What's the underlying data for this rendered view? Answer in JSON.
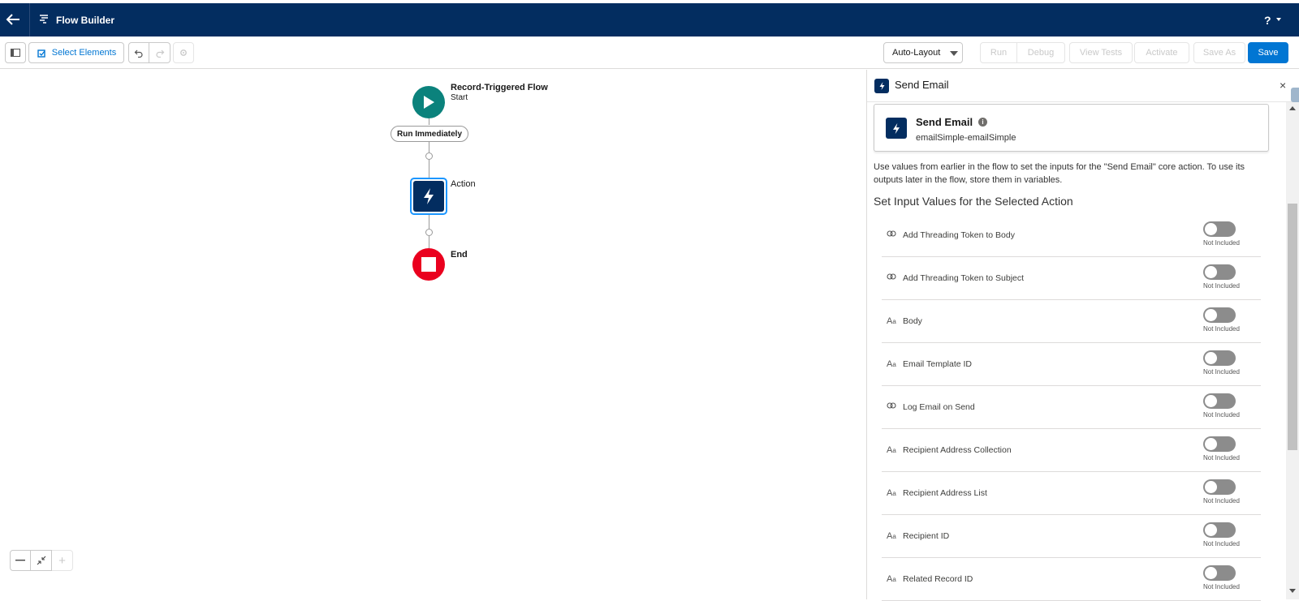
{
  "header": {
    "app_title": "Flow Builder",
    "help_label": "?",
    "back_icon": "back-arrow-icon",
    "app_icon": "flow-icon",
    "bg_color": "#032d60"
  },
  "toolbar": {
    "select_elements_label": "Select Elements",
    "auto_layout_label": "Auto-Layout",
    "run_label": "Run",
    "debug_label": "Debug",
    "view_tests_label": "View Tests",
    "activate_label": "Activate",
    "save_as_label": "Save As",
    "save_label": "Save",
    "accent_color": "#0176d3"
  },
  "canvas": {
    "start_title": "Record-Triggered Flow",
    "start_subtitle": "Start",
    "run_pill_label": "Run Immediately",
    "action_label": "Action",
    "end_label": "End",
    "start_color": "#0b827c",
    "end_color": "#ea001e",
    "zoom_out_label": "—",
    "zoom_in_label": "+"
  },
  "panel": {
    "title": "Send Email",
    "card_title": "Send Email",
    "card_subtitle": "emailSimple-emailSimple",
    "description": "Use values from earlier in the flow to set the inputs for the \"Send Email\" core action. To use its outputs later in the flow, store them in variables.",
    "section_title": "Set Input Values for the Selected Action",
    "close_label": "×",
    "rows": [
      {
        "icon": "boolean-icon",
        "label": "Add Threading Token to Body",
        "status": "Not Included"
      },
      {
        "icon": "boolean-icon",
        "label": "Add Threading Token to Subject",
        "status": "Not Included"
      },
      {
        "icon": "text-icon",
        "label": "Body",
        "status": "Not Included"
      },
      {
        "icon": "text-icon",
        "label": "Email Template ID",
        "status": "Not Included"
      },
      {
        "icon": "boolean-icon",
        "label": "Log Email on Send",
        "status": "Not Included"
      },
      {
        "icon": "text-icon",
        "label": "Recipient Address Collection",
        "status": "Not Included"
      },
      {
        "icon": "text-icon",
        "label": "Recipient Address List",
        "status": "Not Included"
      },
      {
        "icon": "text-icon",
        "label": "Recipient ID",
        "status": "Not Included"
      },
      {
        "icon": "text-icon",
        "label": "Related Record ID",
        "status": "Not Included"
      }
    ]
  }
}
